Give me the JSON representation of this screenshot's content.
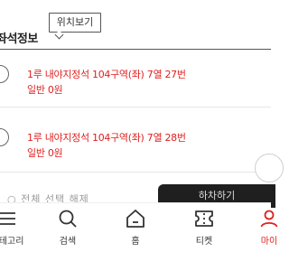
{
  "section": {
    "title": "좌석정보"
  },
  "tooltip": {
    "label": "위치보기"
  },
  "seats": [
    {
      "location": "1루 내야지정석 104구역(좌) 7열 27번",
      "price": "일반 0원"
    },
    {
      "location": "1루 내야지정석 104구역(좌) 7열 28번",
      "price": "일반 0원"
    }
  ],
  "footer": {
    "ghost_text": "○ 전체 선택 해제",
    "button_label": "하차하기"
  },
  "nav": {
    "items": [
      {
        "label": "카테고리",
        "icon": "menu-icon",
        "active": false
      },
      {
        "label": "검색",
        "icon": "search-icon",
        "active": false
      },
      {
        "label": "홈",
        "icon": "home-icon",
        "active": false
      },
      {
        "label": "티켓",
        "icon": "ticket-icon",
        "active": false
      },
      {
        "label": "마이",
        "icon": "person-icon",
        "active": true
      }
    ]
  },
  "colors": {
    "accent": "#e02020",
    "dark": "#1f1f1f"
  }
}
